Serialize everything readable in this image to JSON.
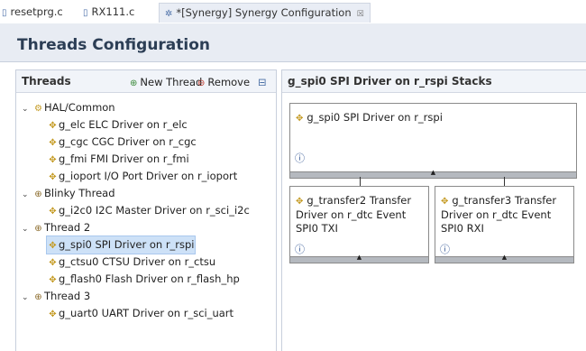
{
  "tabs": [
    {
      "label": "resetprg.c",
      "icon": "c-file-icon"
    },
    {
      "label": "RX111.c",
      "icon": "c-file-icon"
    },
    {
      "label": "*[Synergy] Synergy Configuration",
      "icon": "gear-icon",
      "close": "☒"
    }
  ],
  "page": {
    "title": "Threads Configuration"
  },
  "threads_panel": {
    "title": "Threads",
    "new_thread": "New Thread",
    "remove": "Remove",
    "items": [
      {
        "label": "HAL/Common",
        "kind": "group"
      },
      {
        "label": "g_elc ELC Driver on r_elc"
      },
      {
        "label": "g_cgc CGC Driver on r_cgc"
      },
      {
        "label": "g_fmi FMI Driver on r_fmi"
      },
      {
        "label": "g_ioport I/O Port Driver on r_ioport"
      },
      {
        "label": "Blinky Thread",
        "kind": "thread"
      },
      {
        "label": "g_i2c0 I2C Master Driver on r_sci_i2c"
      },
      {
        "label": "Thread 2",
        "kind": "thread"
      },
      {
        "label": "g_spi0 SPI Driver on r_rspi",
        "selected": true
      },
      {
        "label": "g_ctsu0 CTSU Driver on r_ctsu"
      },
      {
        "label": "g_flash0 Flash Driver on r_flash_hp"
      },
      {
        "label": "Thread 3",
        "kind": "thread"
      },
      {
        "label": "g_uart0 UART Driver on r_sci_uart"
      }
    ]
  },
  "stacks_panel": {
    "title": "g_spi0 SPI Driver on r_rspi Stacks",
    "top_box": {
      "label": "g_spi0 SPI Driver on r_rspi"
    },
    "child_boxes": [
      {
        "line1": "g_transfer2 Transfer",
        "line2": "Driver on r_dtc Event",
        "line3": "SPI0 TXI"
      },
      {
        "line1": "g_transfer3 Transfer",
        "line2": "Driver on r_dtc Event",
        "line3": "SPI0 RXI"
      }
    ]
  }
}
